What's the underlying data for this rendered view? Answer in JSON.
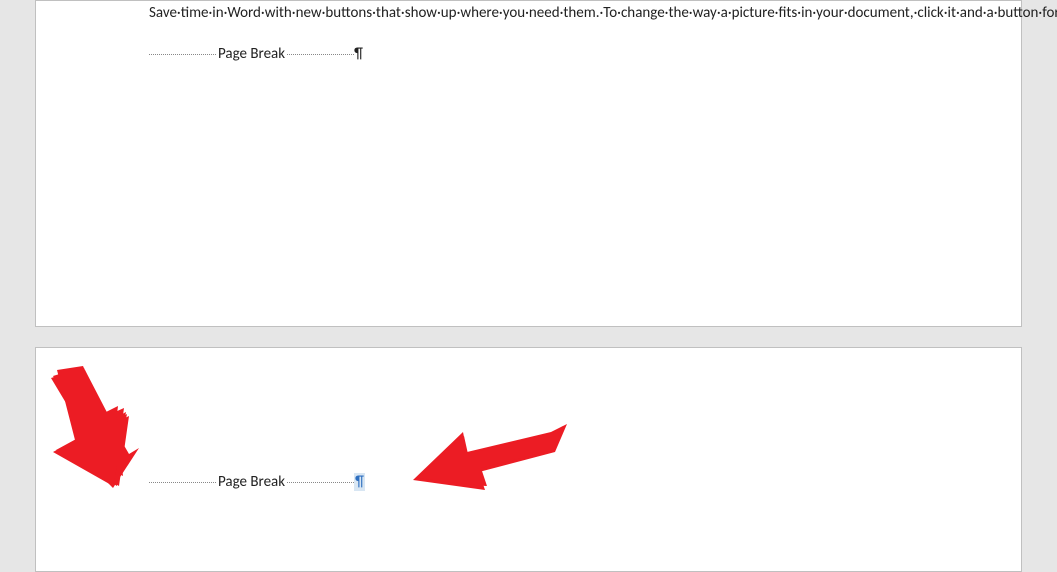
{
  "document": {
    "page1": {
      "paragraph_text": "Save·time·in·Word·with·new·buttons·that·show·up·where·you·need·them.·To·change·the·way·a·picture·fits·in·your·document,·click·it·and·a·button·for·layout·options·appears·next·to·it.·When·you·work·on·a·table,·click·where·you·want·to·add·a·row·or·a·column,·and·then·click·the·plus·sign.¶",
      "page_break_label": "Page Break",
      "page_break_pilcrow": "¶"
    },
    "page2": {
      "page_break_label": "Page Break",
      "page_break_pilcrow": "¶"
    }
  },
  "annotations": {
    "arrow_color": "#ec1c24"
  }
}
